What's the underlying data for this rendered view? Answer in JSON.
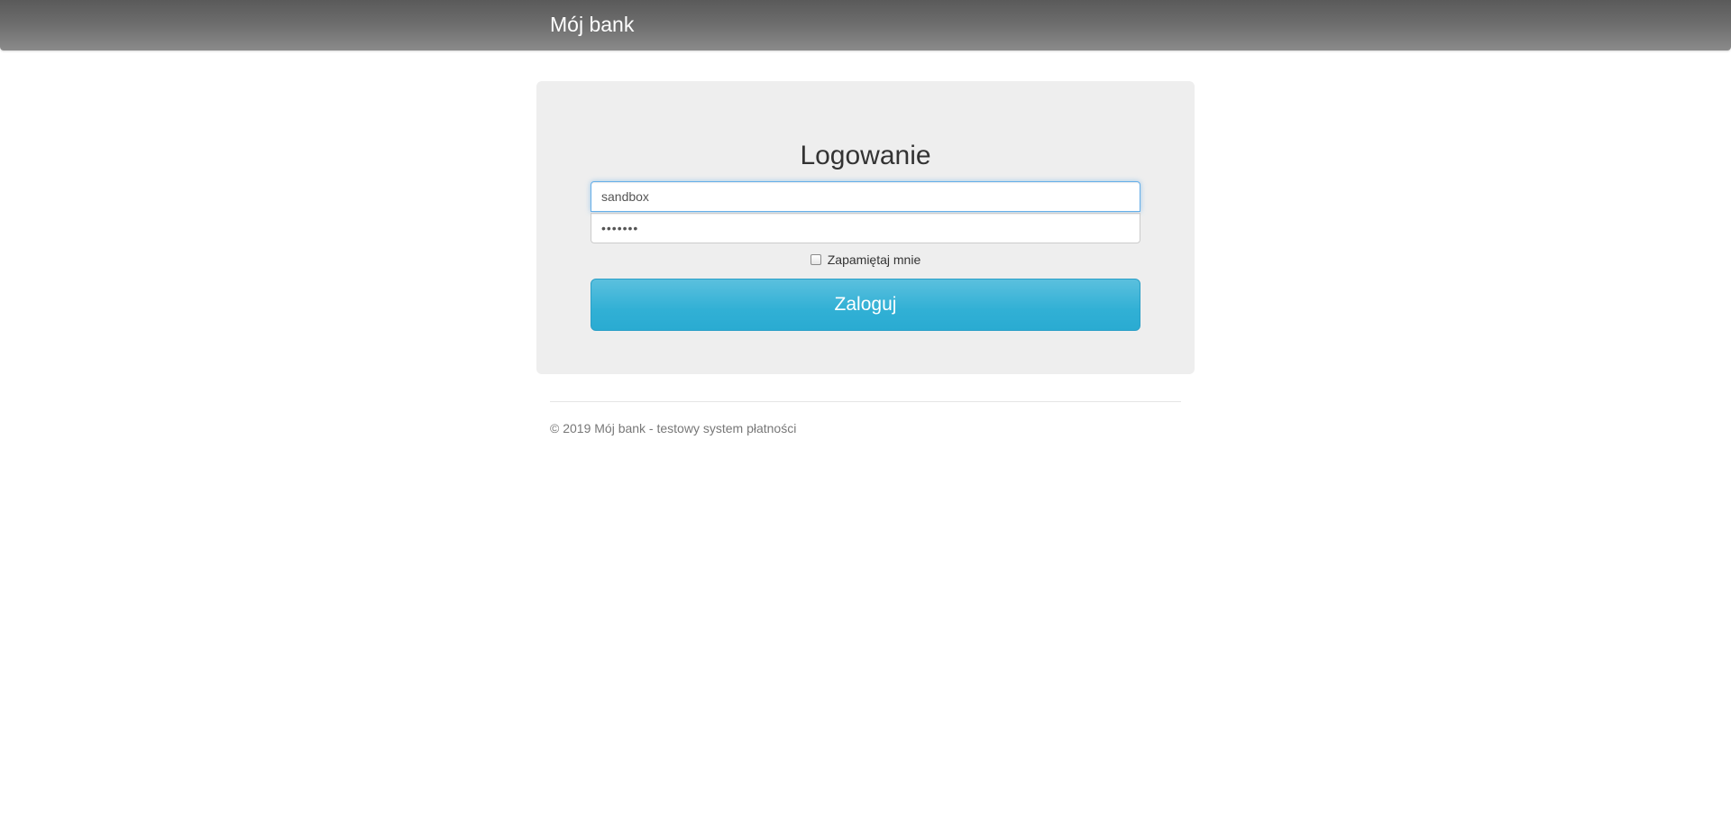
{
  "navbar": {
    "brand": "Mój bank"
  },
  "login": {
    "title": "Logowanie",
    "username_value": "sandbox",
    "password_display": "•••••••",
    "remember_label": "Zapamiętaj mnie",
    "remember_checked": false,
    "submit_label": "Zaloguj"
  },
  "footer": {
    "text": "© 2019 Mój bank - testowy system płatności"
  },
  "colors": {
    "navbar": "#6e6e6e",
    "panel": "#eeeeee",
    "button": "#31b0d5",
    "focus": "#66afe9"
  }
}
